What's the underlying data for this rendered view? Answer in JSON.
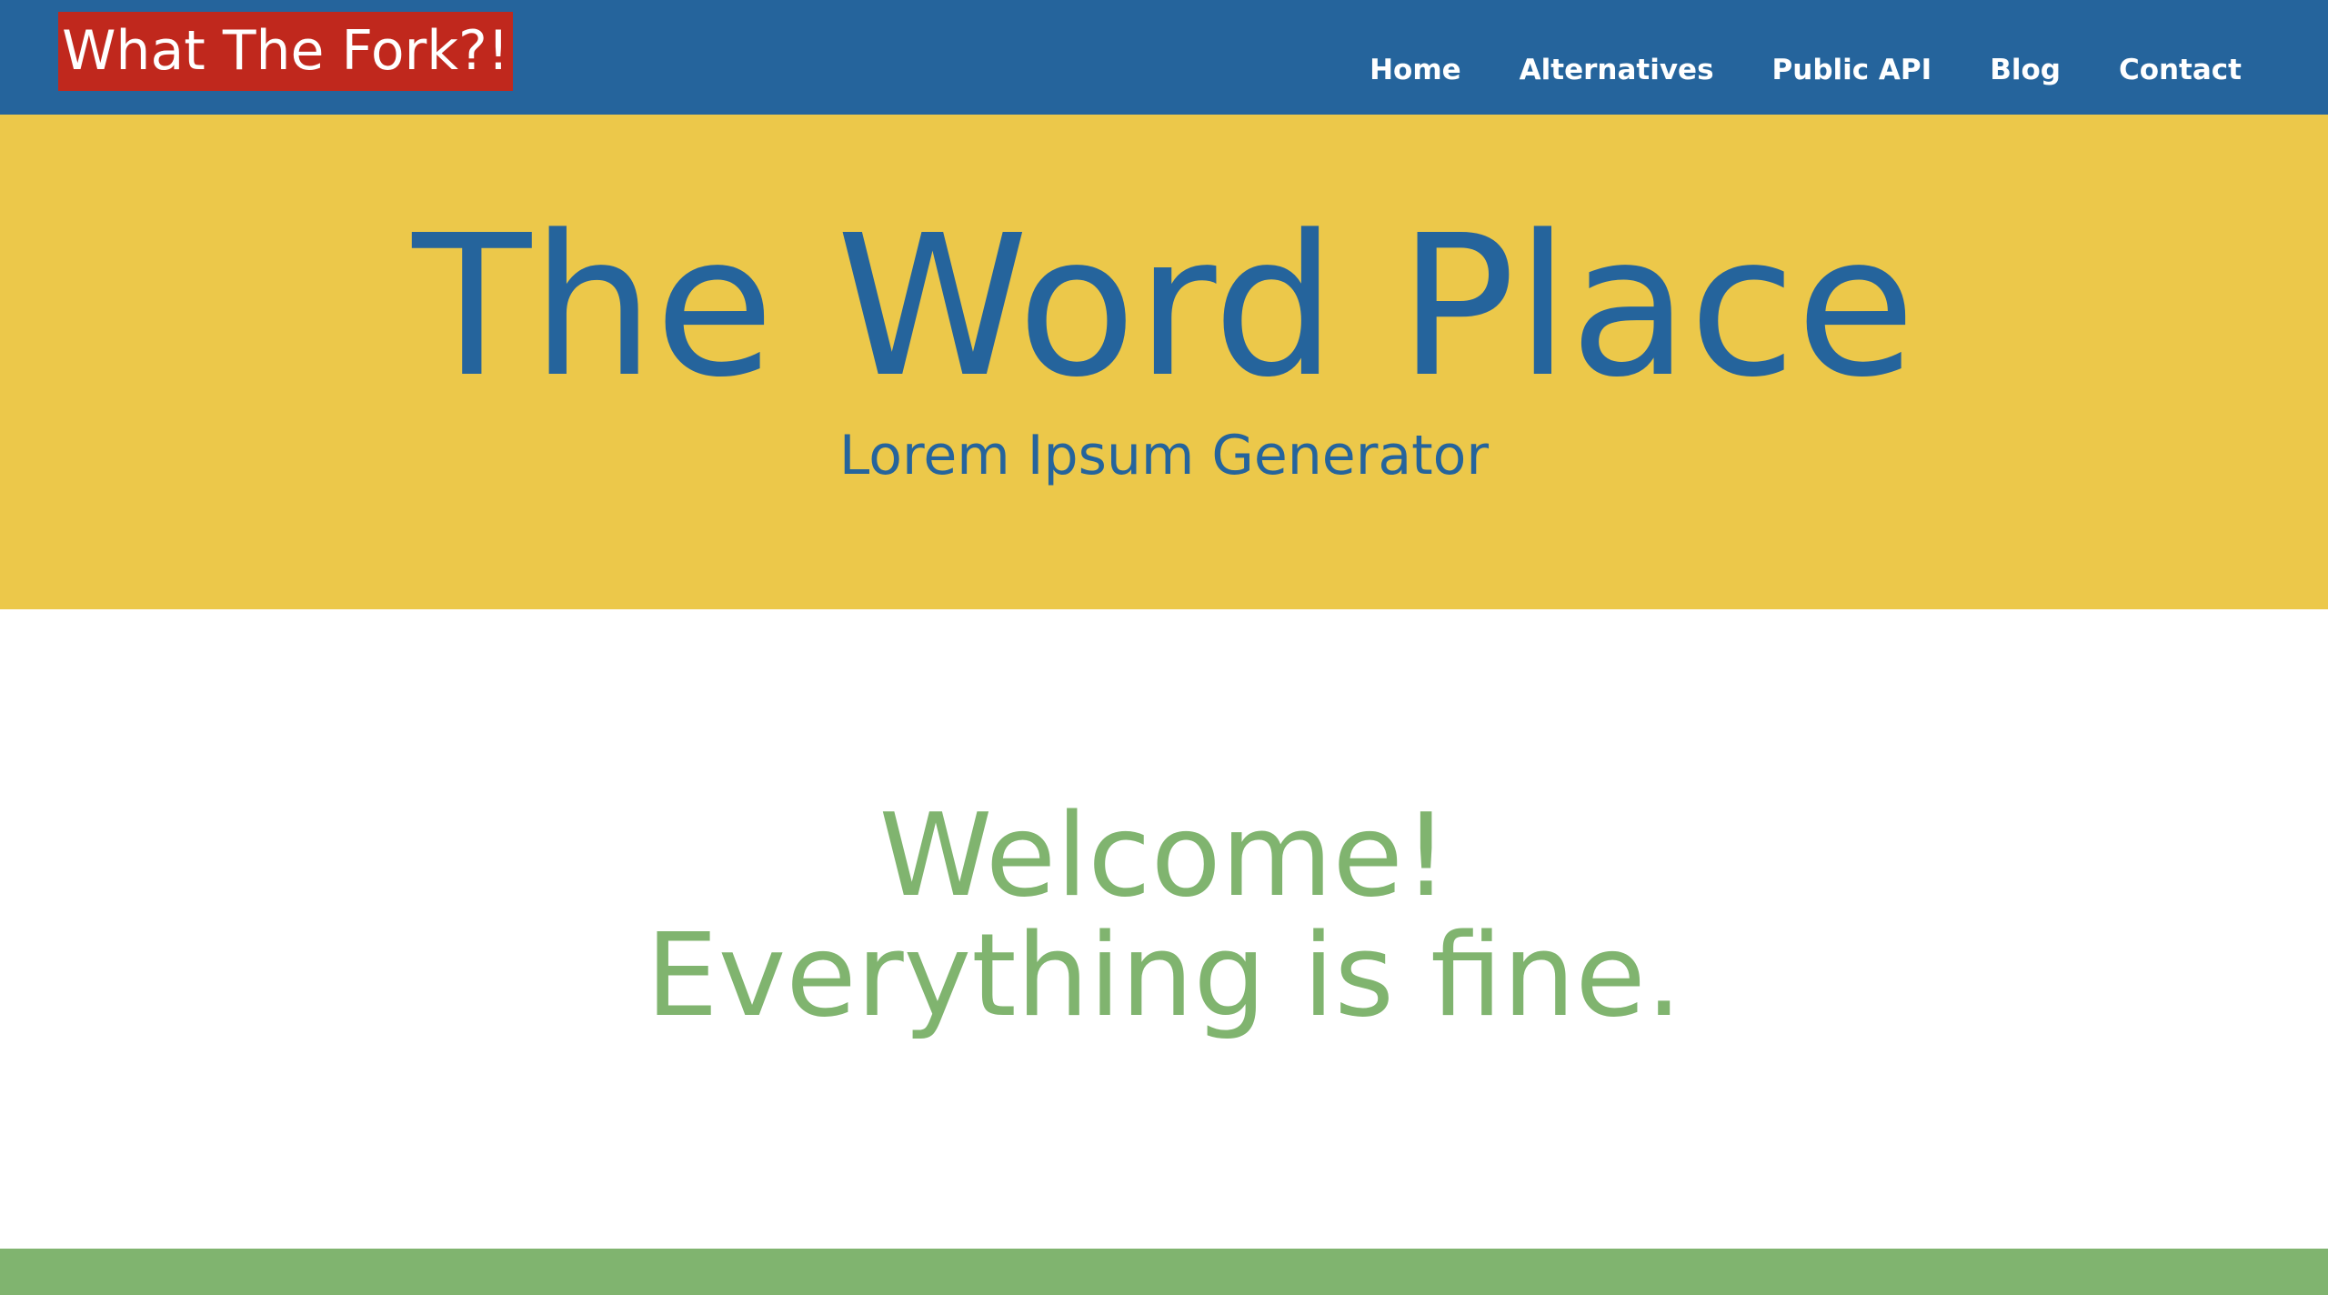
{
  "header": {
    "logo_text": "What The Fork?!",
    "nav": [
      {
        "label": "Home"
      },
      {
        "label": "Alternatives"
      },
      {
        "label": "Public API"
      },
      {
        "label": "Blog"
      },
      {
        "label": "Contact"
      }
    ]
  },
  "hero": {
    "title": "The Word Place",
    "subtitle": "Lorem Ipsum Generator"
  },
  "main": {
    "welcome_line1": "Welcome!",
    "welcome_line2": "Everything is fine."
  },
  "colors": {
    "nav_bg": "#25649c",
    "logo_bg": "#c0281d",
    "hero_bg": "#ecc84a",
    "accent_green": "#80b46f",
    "text_blue": "#25649c"
  }
}
